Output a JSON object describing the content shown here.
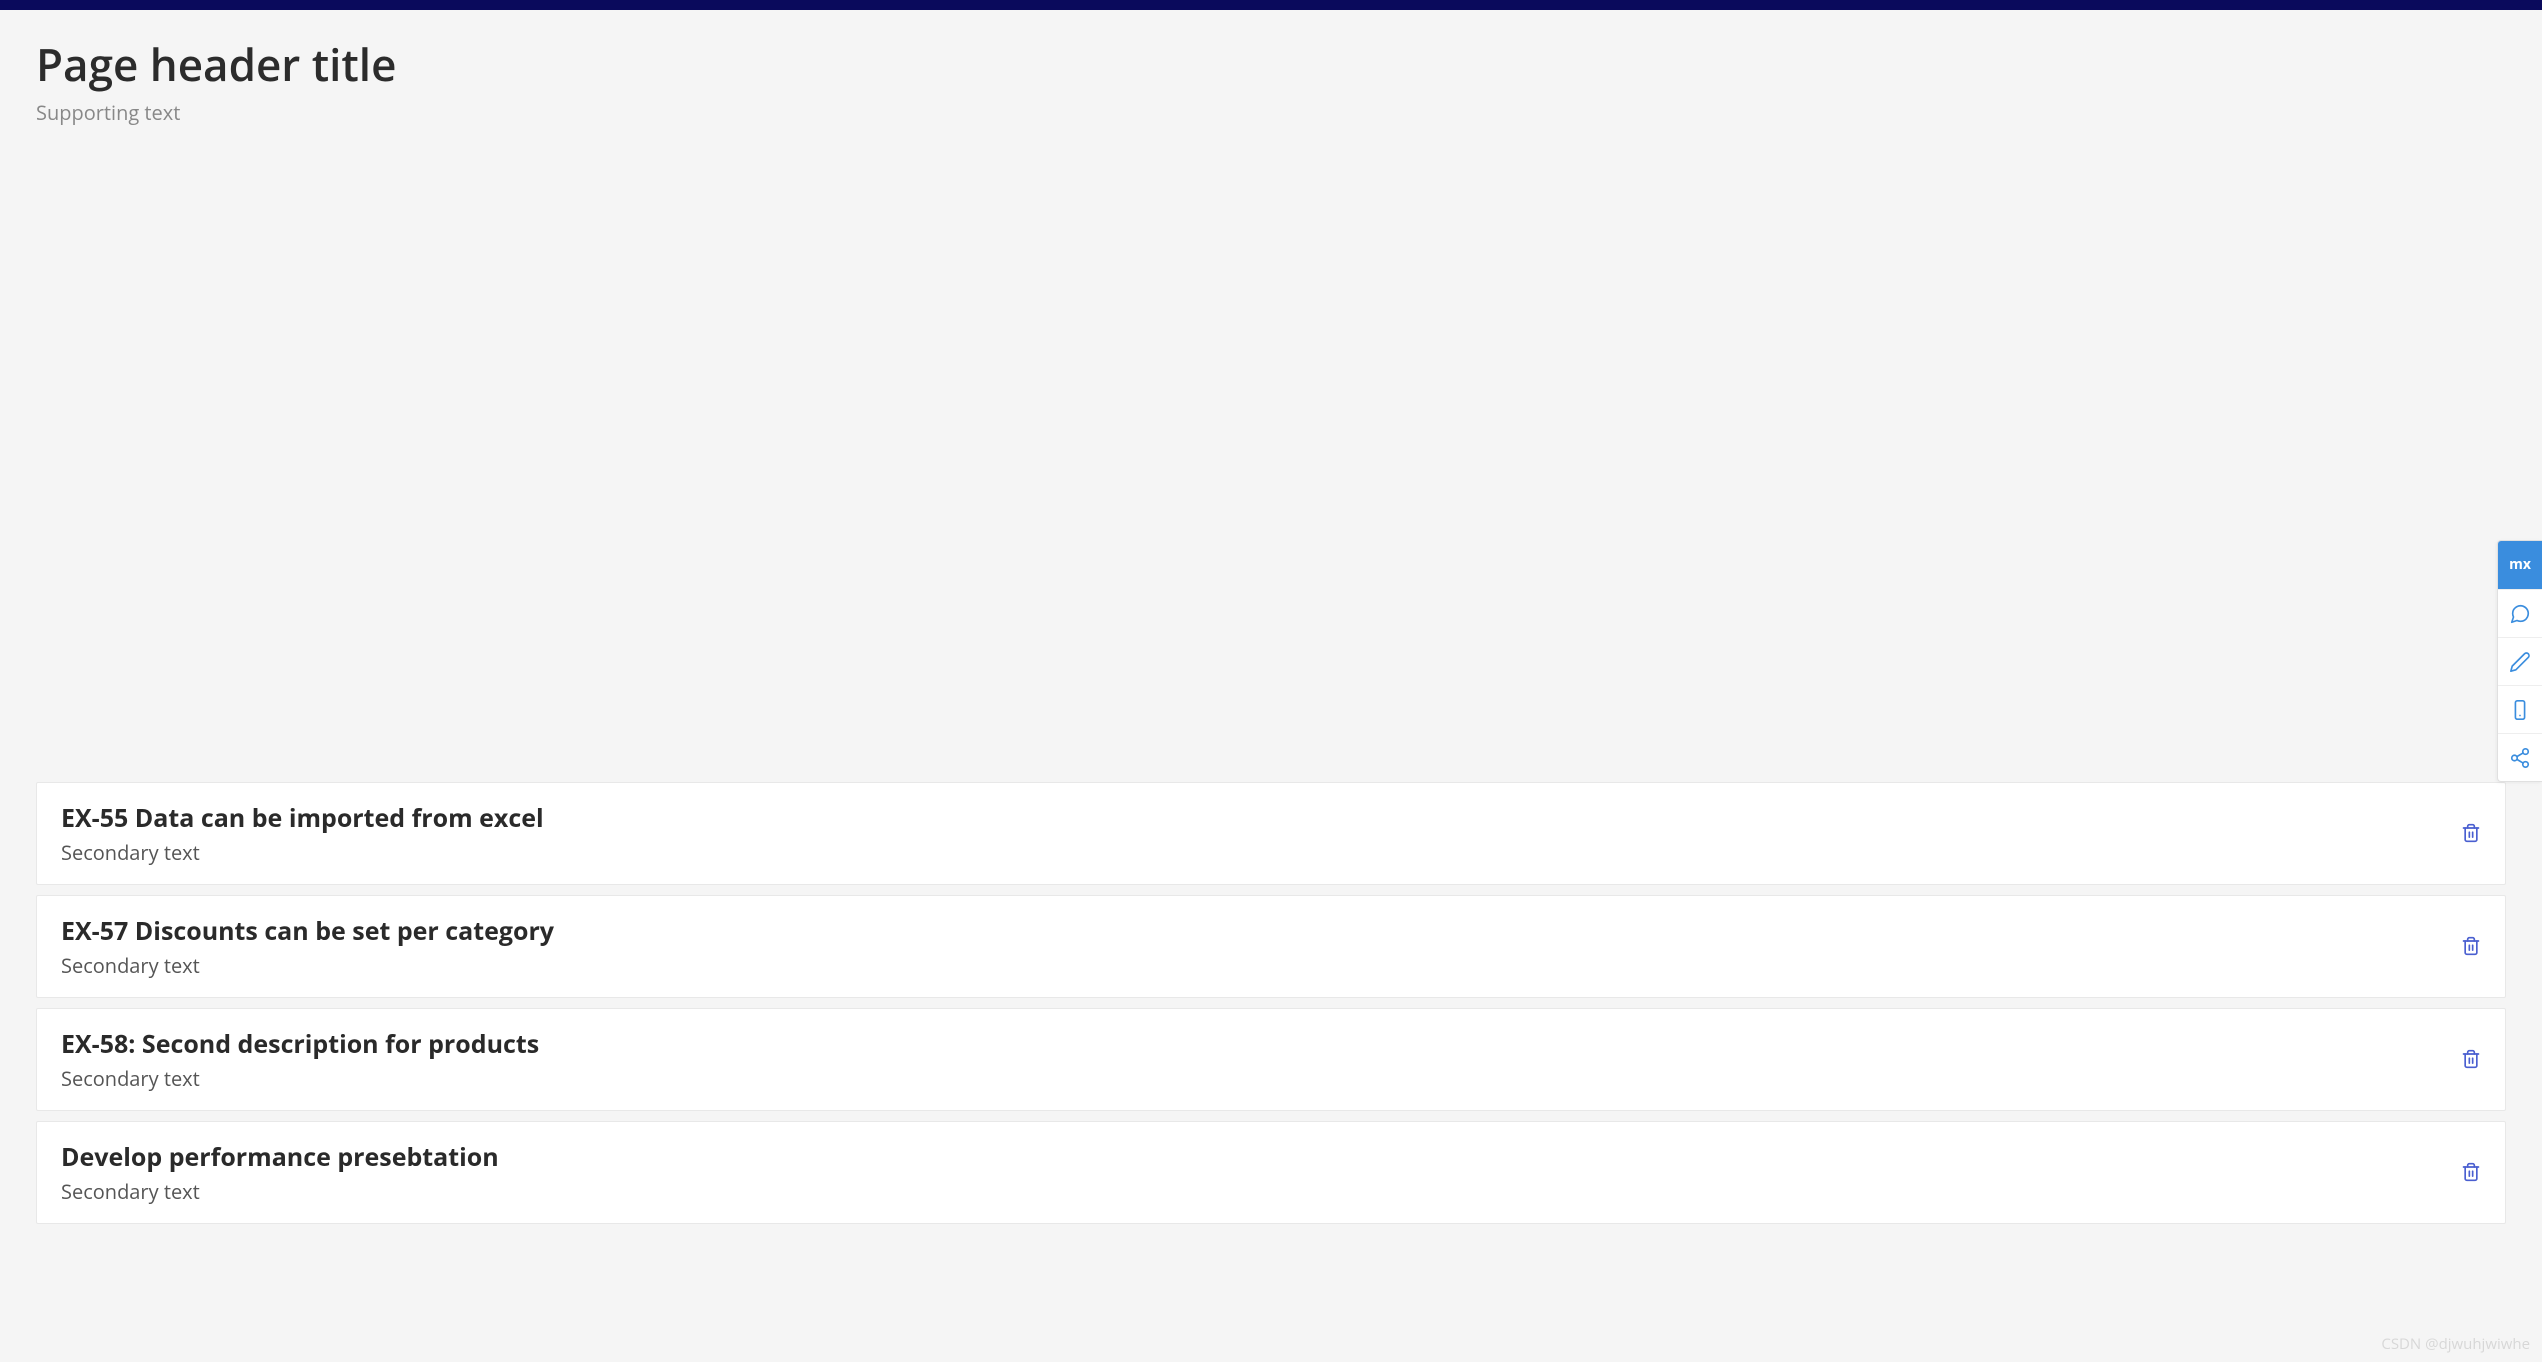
{
  "header": {
    "title": "Page header title",
    "subtitle": "Supporting text"
  },
  "list": {
    "items": [
      {
        "title": "EX-55 Data can be imported from excel",
        "secondary": "Secondary text"
      },
      {
        "title": "EX-57 Discounts can be set per category",
        "secondary": "Secondary text"
      },
      {
        "title": "EX-58: Second description for products",
        "secondary": "Secondary text"
      },
      {
        "title": "Develop performance presebtation",
        "secondary": "Secondary text"
      }
    ]
  },
  "side_toolbar": {
    "items": [
      {
        "name": "mx-logo",
        "active": true,
        "label": "mx"
      },
      {
        "name": "chat-icon",
        "active": false
      },
      {
        "name": "edit-icon",
        "active": false
      },
      {
        "name": "mobile-icon",
        "active": false
      },
      {
        "name": "share-icon",
        "active": false
      }
    ]
  },
  "watermark": "CSDN @djwuhjwiwhe"
}
